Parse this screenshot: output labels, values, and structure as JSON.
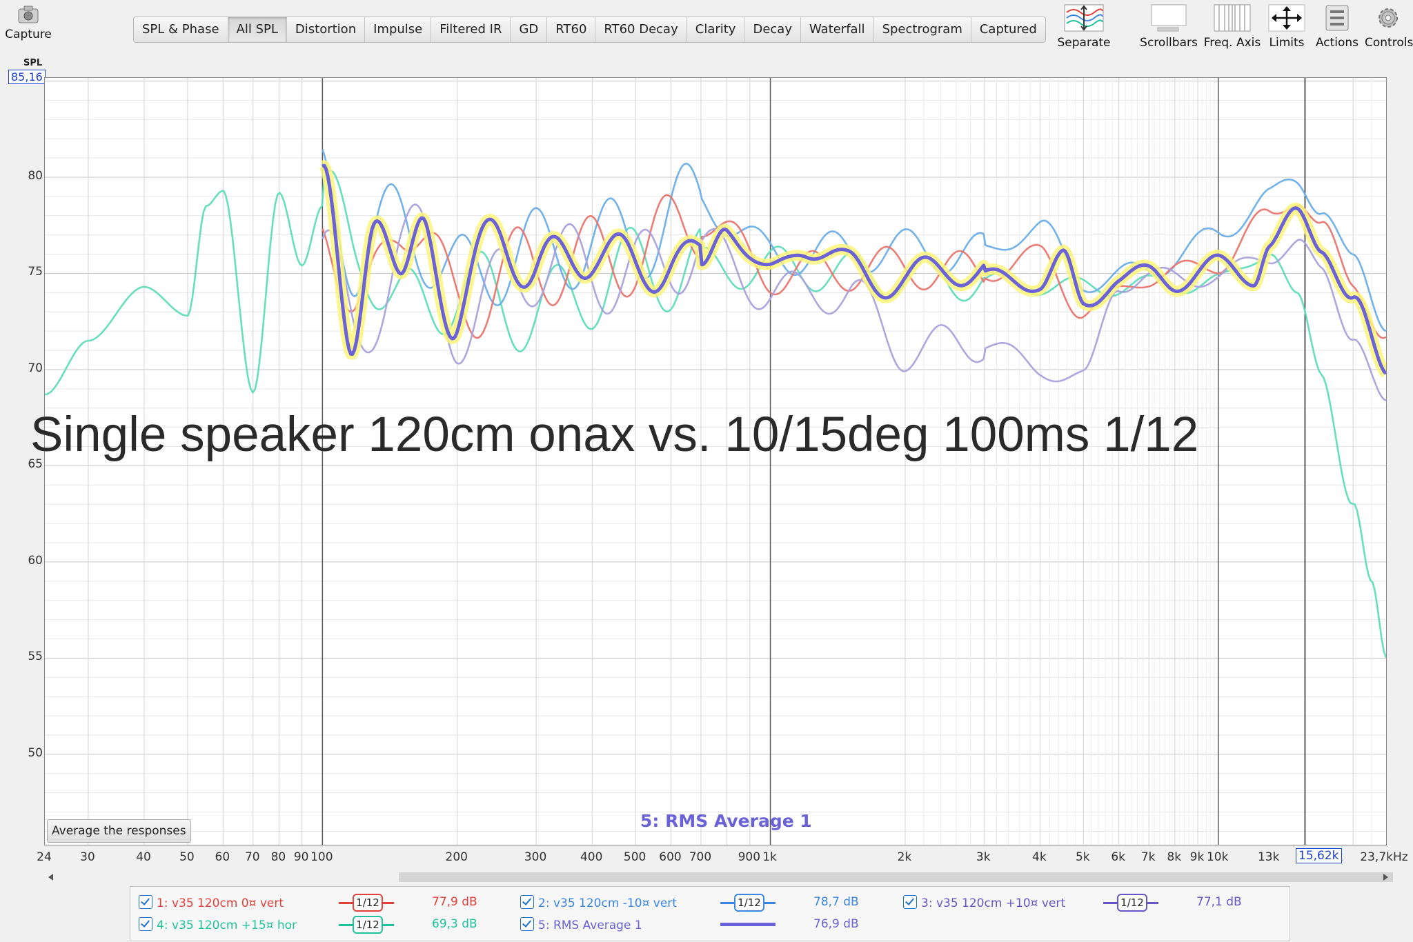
{
  "toolbar": {
    "capture": "Capture",
    "tabs": [
      "SPL & Phase",
      "All SPL",
      "Distortion",
      "Impulse",
      "Filtered IR",
      "GD",
      "RT60",
      "RT60 Decay",
      "Clarity",
      "Decay",
      "Waterfall",
      "Spectrogram",
      "Captured"
    ],
    "active_tab": "All SPL",
    "right_tools": [
      "Separate",
      "Scrollbars",
      "Freq. Axis",
      "Limits",
      "Actions",
      "Controls"
    ]
  },
  "graph": {
    "y_axis_label": "SPL",
    "y_top_readout": "85,16",
    "y_ticks": [
      "80",
      "75",
      "70",
      "65",
      "60",
      "55",
      "50"
    ],
    "x_ticks": [
      "24",
      "30",
      "40",
      "50",
      "60",
      "70",
      "80",
      "90",
      "100",
      "200",
      "300",
      "400",
      "500",
      "600",
      "700",
      "900",
      "1k",
      "2k",
      "3k",
      "4k",
      "5k",
      "6k",
      "7k",
      "8k",
      "9k",
      "10k",
      "13k",
      "18k",
      "23,7kHz"
    ],
    "cursor_readout": "15,62k",
    "overlay_title": "Single speaker 120cm onax vs. 10/15deg 100ms 1/12",
    "average_button": "Average the responses",
    "rms_label": "5: RMS Average 1"
  },
  "legend": [
    {
      "label": "1: v35 120cm 0¤ vert",
      "smoothing": "1/12",
      "value": "77,9 dB",
      "color": "#e0413a"
    },
    {
      "label": "2: v35 120cm -10¤ vert",
      "smoothing": "1/12",
      "value": "78,7 dB",
      "color": "#3a86e0"
    },
    {
      "label": "3: v35 120cm +10¤ vert",
      "smoothing": "1/12",
      "value": "77,1 dB",
      "color": "#6656c8"
    },
    {
      "label": "4: v35 120cm +15¤ hor",
      "smoothing": "1/12",
      "value": "69,3 dB",
      "color": "#1fc29a"
    },
    {
      "label": "5: RMS Average 1",
      "smoothing": "",
      "value": "76,9 dB",
      "color": "#6b62d8"
    }
  ],
  "chart_data": {
    "type": "line",
    "xlabel": "",
    "ylabel": "SPL",
    "x_scale": "log",
    "xlim": [
      24,
      23700
    ],
    "ylim": [
      45.3,
      85.16
    ],
    "grid": true,
    "series": [
      {
        "name": "4: v35 120cm +15¤ hor",
        "color": "#5fdcb8",
        "x": [
          24,
          30,
          40,
          50,
          55,
          60,
          70,
          80,
          90,
          100,
          120,
          150,
          200,
          300,
          500,
          1000,
          2000,
          5000,
          10000,
          13000,
          15000,
          17000,
          20000,
          22000,
          23700
        ],
        "y": [
          68.7,
          71.5,
          74.3,
          72.8,
          78.5,
          79.3,
          68.8,
          79.2,
          75.4,
          78.5,
          76.5,
          73.0,
          74.2,
          73.0,
          75.2,
          75.3,
          74.8,
          74.3,
          74.5,
          76.3,
          73.5,
          70.0,
          63.0,
          58.5,
          54.9
        ]
      },
      {
        "name": "2: v35 120cm -10¤ vert",
        "color": "#6aaee8",
        "x": [
          100,
          120,
          150,
          200,
          300,
          500,
          700,
          1000,
          2000,
          3000,
          4000,
          5000,
          7000,
          10000,
          13000,
          15000,
          17000,
          20000,
          23700
        ],
        "y": [
          79.8,
          75.8,
          77.8,
          74.8,
          76.2,
          76.8,
          78.8,
          76.0,
          76.2,
          76.0,
          77.5,
          74.5,
          75.2,
          77.0,
          79.0,
          79.8,
          78.5,
          75.5,
          72.5
        ]
      },
      {
        "name": "1: v35 120cm 0¤ vert",
        "color": "#e8766e",
        "x": [
          100,
          120,
          150,
          200,
          300,
          500,
          700,
          1000,
          2000,
          3000,
          4000,
          5000,
          7000,
          10000,
          13000,
          15000,
          17000,
          20000,
          23700
        ],
        "y": [
          79.0,
          72.0,
          78.5,
          73.5,
          75.5,
          76.0,
          78.0,
          75.0,
          75.3,
          75.0,
          76.0,
          73.0,
          74.8,
          75.5,
          78.0,
          79.0,
          77.3,
          74.5,
          71.7
        ]
      },
      {
        "name": "3: v35 120cm +10¤ vert",
        "color": "#a9a2dc",
        "x": [
          100,
          120,
          150,
          200,
          300,
          500,
          700,
          1000,
          1500,
          2000,
          3000,
          4000,
          5000,
          6000,
          7000,
          10000,
          13000,
          15000,
          17000,
          20000,
          23700
        ],
        "y": [
          78.0,
          70.2,
          77.5,
          72.5,
          75.5,
          75.0,
          76.5,
          74.0,
          74.0,
          71.0,
          71.5,
          70.0,
          69.5,
          74.5,
          74.8,
          74.8,
          76.0,
          76.5,
          75.0,
          72.0,
          67.9
        ]
      },
      {
        "name": "5: RMS Average 1",
        "color": "#6b62d8",
        "x": [
          100,
          115,
          130,
          150,
          170,
          200,
          250,
          300,
          400,
          500,
          600,
          700,
          800,
          1000,
          1200,
          1500,
          2000,
          2500,
          3000,
          4000,
          4500,
          5000,
          6000,
          7000,
          8000,
          10000,
          12000,
          13000,
          15000,
          17000,
          20000,
          23700
        ],
        "y": [
          78.8,
          71.5,
          79.0,
          73.0,
          78.5,
          72.0,
          78.0,
          74.5,
          76.8,
          74.5,
          76.7,
          74.5,
          78.0,
          74.5,
          76.8,
          75.2,
          74.5,
          75.5,
          74.8,
          74.5,
          75.8,
          73.3,
          74.8,
          75.0,
          74.5,
          75.5,
          74.8,
          76.5,
          78.0,
          76.5,
          73.5,
          69.9
        ]
      }
    ]
  }
}
